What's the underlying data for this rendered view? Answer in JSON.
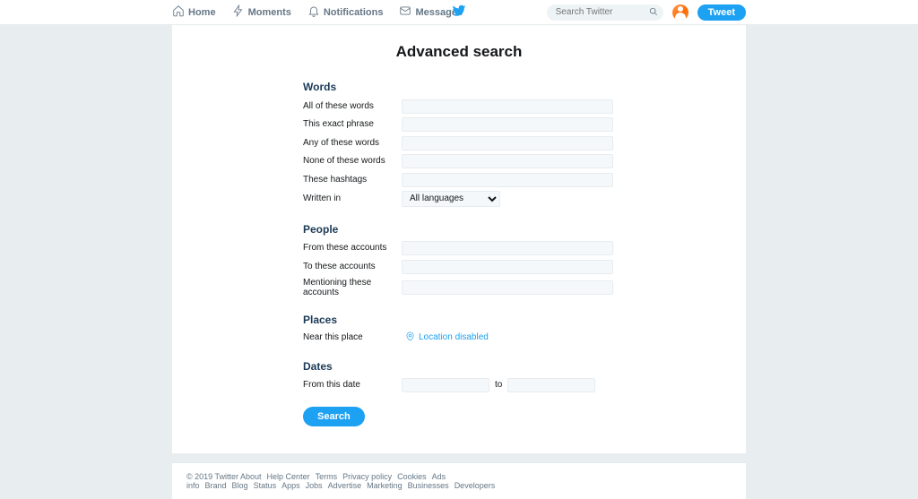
{
  "topnav": {
    "home": "Home",
    "moments": "Moments",
    "notifications": "Notifications",
    "messages": "Messages",
    "search_placeholder": "Search Twitter",
    "tweet": "Tweet"
  },
  "page": {
    "title": "Advanced search"
  },
  "sections": {
    "words": {
      "title": "Words",
      "all_words": "All of these words",
      "exact_phrase": "This exact phrase",
      "any_words": "Any of these words",
      "none_words": "None of these words",
      "hashtags": "These hashtags",
      "written_in": "Written in",
      "language_selected": "All languages"
    },
    "people": {
      "title": "People",
      "from_accounts": "From these accounts",
      "to_accounts": "To these accounts",
      "mentioning": "Mentioning these accounts"
    },
    "places": {
      "title": "Places",
      "near_place": "Near this place",
      "location_disabled": "Location disabled"
    },
    "dates": {
      "title": "Dates",
      "from_date": "From this date",
      "to": "to"
    }
  },
  "buttons": {
    "search": "Search"
  },
  "footer": {
    "copyright": "© 2019 Twitter",
    "links": [
      "About",
      "Help Center",
      "Terms",
      "Privacy policy",
      "Cookies",
      "Ads info",
      "Brand",
      "Blog",
      "Status",
      "Apps",
      "Jobs",
      "Advertise",
      "Marketing",
      "Businesses",
      "Developers"
    ]
  }
}
